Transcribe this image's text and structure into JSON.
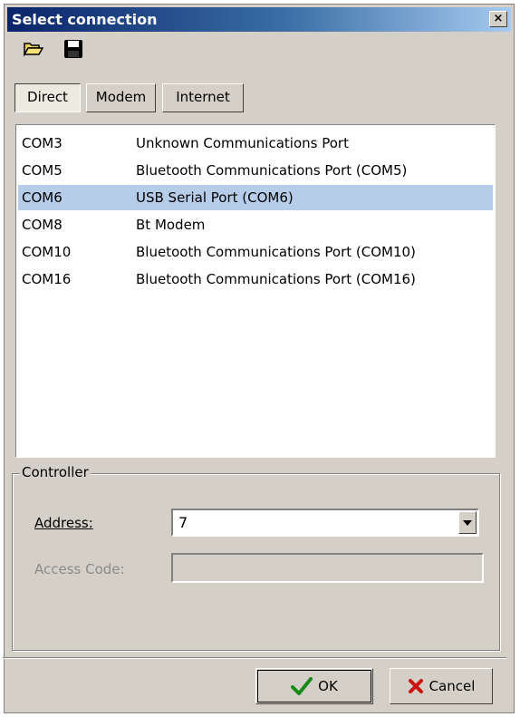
{
  "window": {
    "title": "Select connection",
    "close_label": "×"
  },
  "toolbar": {
    "open_icon": "folder-open-icon",
    "save_icon": "floppy-save-icon"
  },
  "tabs": [
    {
      "label": "Direct",
      "active": true
    },
    {
      "label": "Modem",
      "active": false
    },
    {
      "label": "Internet",
      "active": false
    }
  ],
  "ports": [
    {
      "port": "COM3",
      "description": "Unknown Communications Port",
      "selected": false
    },
    {
      "port": "COM5",
      "description": "Bluetooth Communications Port (COM5)",
      "selected": false
    },
    {
      "port": "COM6",
      "description": "USB Serial Port (COM6)",
      "selected": true
    },
    {
      "port": "COM8",
      "description": "Bt Modem",
      "selected": false
    },
    {
      "port": "COM10",
      "description": "Bluetooth Communications Port (COM10)",
      "selected": false
    },
    {
      "port": "COM16",
      "description": "Bluetooth Communications Port (COM16)",
      "selected": false
    }
  ],
  "controller": {
    "group_label": "Controller",
    "address_label": "Address:",
    "address_value": "7",
    "access_code_label": "Access Code:",
    "access_code_value": ""
  },
  "buttons": {
    "ok_label": "OK",
    "cancel_label": "Cancel"
  },
  "colors": {
    "titlebar_start": "#0a246a",
    "titlebar_end": "#a6caf0",
    "selection": "#b6cde9",
    "face": "#d4d0c8",
    "ok_check": "#1a8a1a",
    "cancel_x": "#cc1111"
  }
}
